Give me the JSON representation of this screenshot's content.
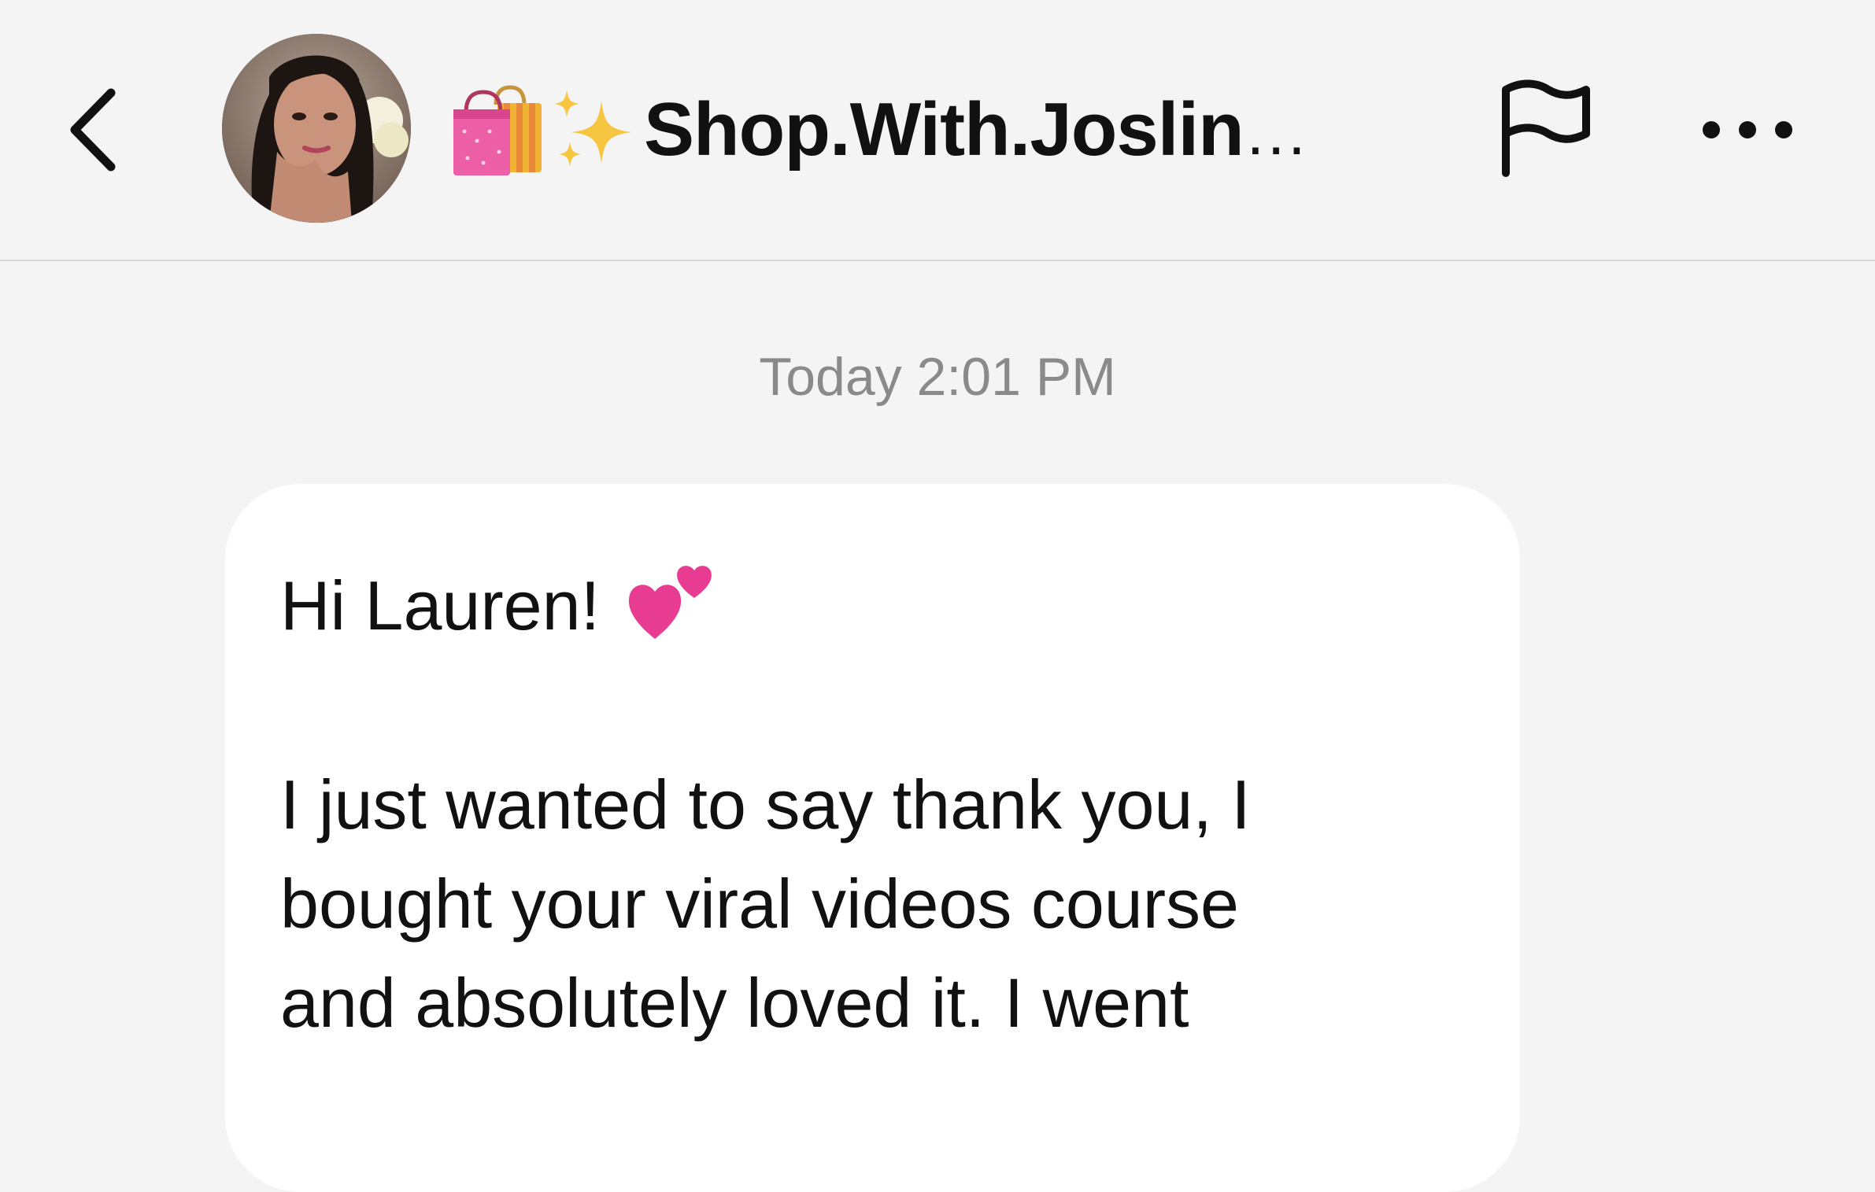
{
  "header": {
    "back_icon": "chevron-left-icon",
    "avatar_alt": "profile photo",
    "title_emojis": [
      "shopping-bags-emoji",
      "sparkles-emoji"
    ],
    "title": "Shop.With.Joslin",
    "title_ellipsis": "...",
    "flag_icon": "flag-icon",
    "more_icon": "more-horizontal-icon"
  },
  "conversation": {
    "timestamp": "Today 2:01 PM",
    "message": {
      "greeting": "Hi Lauren!",
      "greeting_emoji": "two-hearts-emoji",
      "lines": [
        "I just wanted to say thank you, I",
        "bought your viral videos course",
        "and absolutely loved it. I went"
      ]
    }
  },
  "colors": {
    "background": "#f4f4f4",
    "bubble": "#ffffff",
    "timestamp": "#8a8a8a",
    "text": "#111111",
    "divider": "#d9d9d9"
  }
}
